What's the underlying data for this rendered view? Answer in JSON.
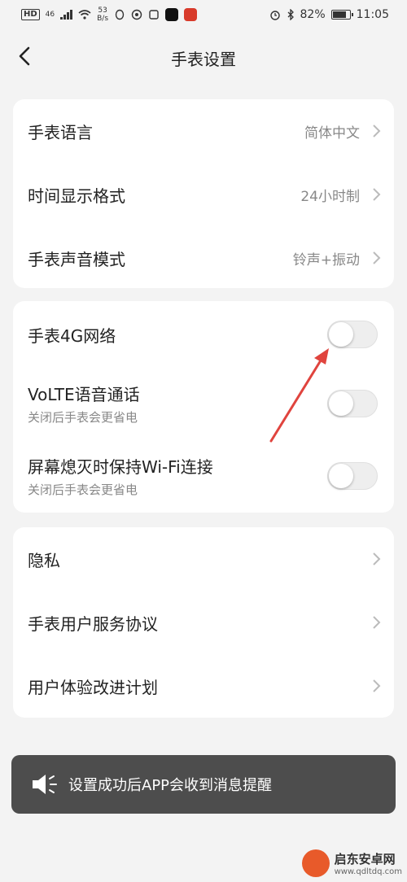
{
  "status_bar": {
    "hd": "HD",
    "net_type": "46",
    "speed_value": "53",
    "speed_unit": "B/s",
    "battery_percent": "82%",
    "time": "11:05"
  },
  "header": {
    "title": "手表设置"
  },
  "section1": {
    "rows": [
      {
        "label": "手表语言",
        "value": "简体中文"
      },
      {
        "label": "时间显示格式",
        "value": "24小时制"
      },
      {
        "label": "手表声音模式",
        "value": "铃声+振动"
      }
    ]
  },
  "section2": {
    "rows": [
      {
        "label": "手表4G网络",
        "sub": "",
        "enabled": false
      },
      {
        "label": "VoLTE语音通话",
        "sub": "关闭后手表会更省电",
        "enabled": false
      },
      {
        "label": "屏幕熄灭时保持Wi-Fi连接",
        "sub": "关闭后手表会更省电",
        "enabled": false
      }
    ]
  },
  "section3": {
    "rows": [
      {
        "label": "隐私"
      },
      {
        "label": "手表用户服务协议"
      },
      {
        "label": "用户体验改进计划"
      }
    ]
  },
  "toast": {
    "message": "设置成功后APP会收到消息提醒"
  },
  "watermark": {
    "name": "启东安卓网",
    "url": "www.qdltdq.com"
  },
  "colors": {
    "background": "#f3f3f3",
    "card": "#ffffff",
    "annotation_arrow": "#e0443e",
    "toast_bg": "#4d4d4d"
  }
}
